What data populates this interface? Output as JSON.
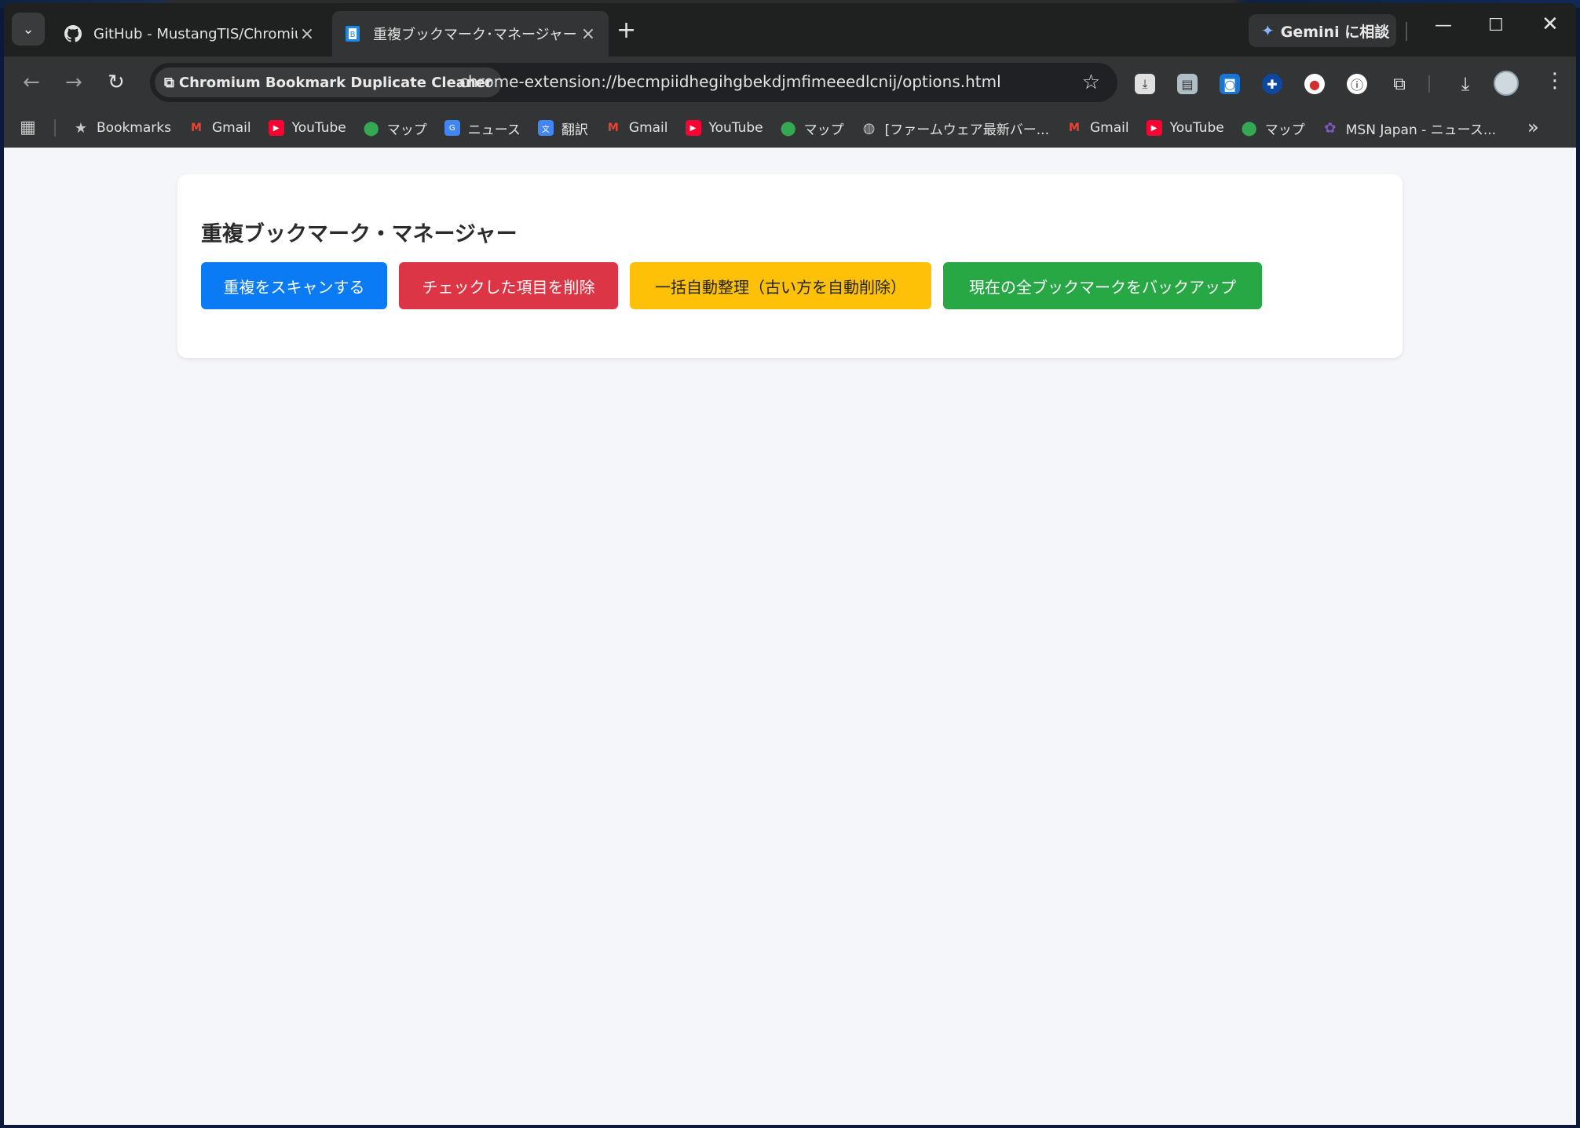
{
  "tabs": [
    {
      "title": "GitHub - MustangTIS/Chromium",
      "active": false
    },
    {
      "title": "重複ブックマーク･マネージャー",
      "active": true
    }
  ],
  "gemini_label": "Gemini に相談",
  "omnibox": {
    "site_chip": "Chromium Bookmark Duplicate Cleaner",
    "url": "chrome-extension://becmpiidhegihgbekdjmfimeeedlcnij/options.html"
  },
  "bookmarks": [
    {
      "label": "Bookmarks",
      "icon": "star-icon"
    },
    {
      "label": "Gmail",
      "icon": "gmail-icon"
    },
    {
      "label": "YouTube",
      "icon": "youtube-icon"
    },
    {
      "label": "マップ",
      "icon": "maps-icon"
    },
    {
      "label": "ニュース",
      "icon": "news-icon"
    },
    {
      "label": "翻訳",
      "icon": "translate-icon"
    },
    {
      "label": "Gmail",
      "icon": "gmail-icon"
    },
    {
      "label": "YouTube",
      "icon": "youtube-icon"
    },
    {
      "label": "マップ",
      "icon": "maps-icon"
    },
    {
      "label": "[ファームウェア最新バー...",
      "icon": "globe-icon"
    },
    {
      "label": "Gmail",
      "icon": "gmail-icon"
    },
    {
      "label": "YouTube",
      "icon": "youtube-icon"
    },
    {
      "label": "マップ",
      "icon": "maps-icon"
    },
    {
      "label": "MSN Japan - ニュース...",
      "icon": "msn-icon"
    }
  ],
  "page": {
    "heading": "重複ブックマーク・マネージャー",
    "buttons": {
      "scan": "重複をスキャンする",
      "delete": "チェックした項目を削除",
      "auto": "一括自動整理（古い方を自動削除）",
      "backup": "現在の全ブックマークをバックアップ"
    }
  },
  "colors": {
    "scan": "#0a7bf5",
    "delete": "#dc3545",
    "auto": "#ffc107",
    "backup": "#28a745"
  }
}
